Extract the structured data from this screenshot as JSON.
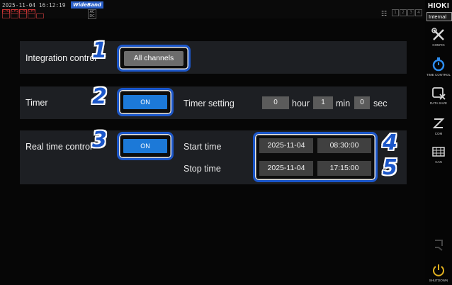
{
  "status": {
    "datetime": "2025-11-04 16:12:19",
    "mode_badge": "WideBand",
    "ch_upper": [
      "CH1",
      "CH2",
      "CH3",
      "CH4"
    ],
    "ch_lower": [
      "",
      "",
      "",
      "",
      ""
    ],
    "acdc": "AC DC",
    "channel_slots": [
      "1",
      "2",
      "3",
      "4"
    ]
  },
  "integration": {
    "label": "Integration control",
    "button": "All channels"
  },
  "timer": {
    "label": "Timer",
    "toggle": "ON",
    "setting_label": "Timer setting",
    "hour_value": "0",
    "hour_unit": "hour",
    "min_value": "1",
    "min_unit": "min",
    "sec_value": "0",
    "sec_unit": "sec"
  },
  "realtime": {
    "label": "Real time control",
    "toggle": "ON",
    "start_label": "Start time",
    "start_date": "2025-11-04",
    "start_time": "08:30:00",
    "stop_label": "Stop time",
    "stop_date": "2025-11-04",
    "stop_time": "17:15:00"
  },
  "callouts": [
    "1",
    "2",
    "3",
    "4",
    "5"
  ],
  "sidebar": {
    "brand": "HIOKI",
    "source": "Internal",
    "items": [
      {
        "label": "CONFIG",
        "icon": "tools-icon"
      },
      {
        "label": "TIME CONTROL",
        "icon": "stopwatch-icon"
      },
      {
        "label": "DATA SAVE",
        "icon": "data-save-icon"
      },
      {
        "label": "COM",
        "icon": "com-icon"
      },
      {
        "label": "CAN",
        "icon": "can-icon"
      },
      {
        "label": "",
        "icon": "disabled-icon"
      },
      {
        "label": "SHUTDOWN",
        "icon": "shutdown-icon"
      }
    ]
  },
  "colors": {
    "accent_blue": "#1b56c9",
    "toggle_blue": "#1c79d8",
    "panel": "#1d1f23",
    "background": "#060606"
  }
}
